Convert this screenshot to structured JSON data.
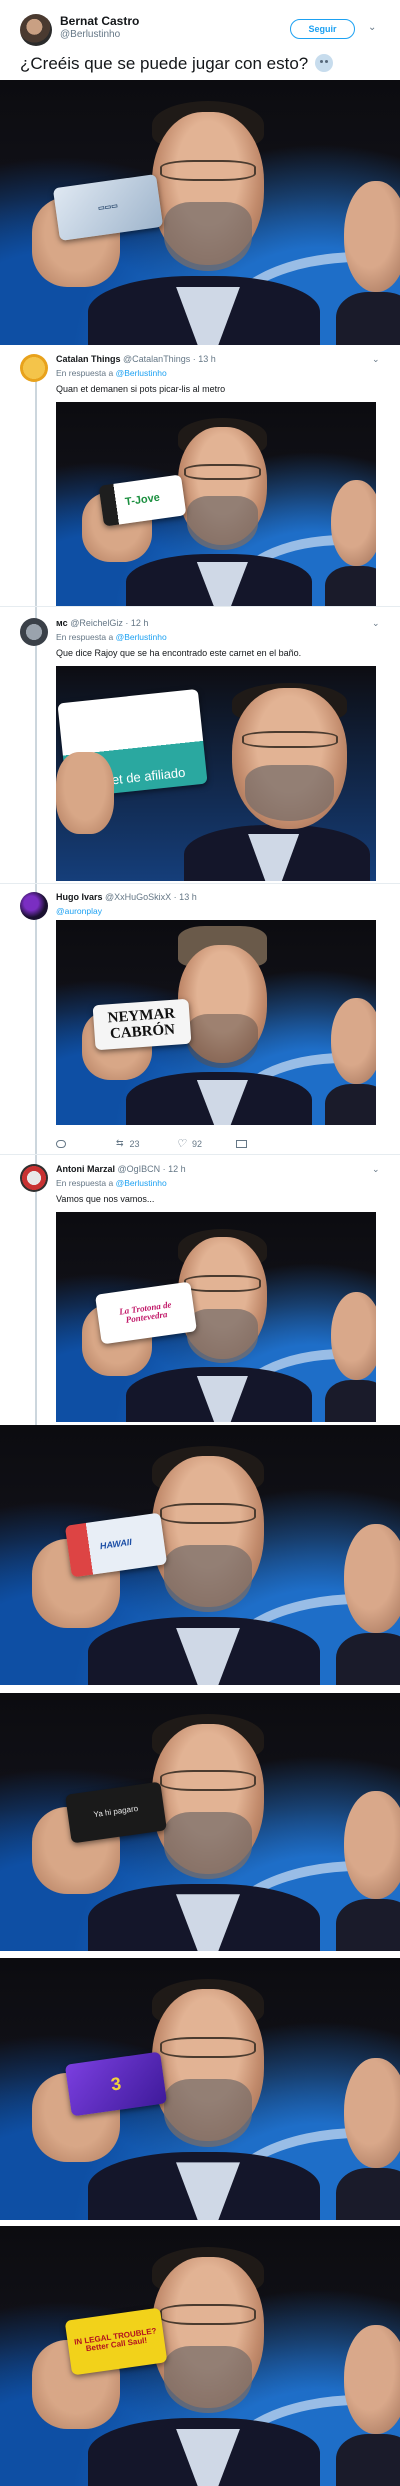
{
  "main_tweet": {
    "author_name": "Bernat Castro",
    "author_handle": "@Berlustinho",
    "follow_label": "Seguir",
    "text": "¿Creéis que se puede jugar con esto?",
    "emoji": "confused-face"
  },
  "replies": [
    {
      "name": "Catalan Things",
      "handle": "@CatalanThings · 13 h",
      "in_reply_prefix": "En respuesta a",
      "in_reply_to": "@Berlustinho",
      "text": "Quan et demanen si pots picar-lis al metro",
      "card_text": "T-Jove"
    },
    {
      "name": "ᴍᴄ",
      "handle": "@ReichelGiz · 12 h",
      "in_reply_prefix": "En respuesta a",
      "in_reply_to": "@Berlustinho",
      "text": "Que dice Rajoy que se ha encontrado este carnet en el baño.",
      "card_text": "carnet de afiliado"
    },
    {
      "name": "Hugo Ivars",
      "handle": "@XxHuGoSkixX · 13 h",
      "mention": "@auronplay",
      "card_text": "NEYMAR CABRÓN",
      "actions": {
        "retweets": "23",
        "likes": "92"
      }
    },
    {
      "name": "Antoni Marzal",
      "handle": "@OgIBCN · 12 h",
      "in_reply_prefix": "En respuesta a",
      "in_reply_to": "@Berlustinho",
      "text": "Vamos que nos vamos...",
      "card_text": "La Trotona de Pontevedra"
    }
  ],
  "extra_photos": [
    {
      "card_text": "HAWAII",
      "card_color": "#e8eef6"
    },
    {
      "card_text": "Ya hi pagaro",
      "card_color": "#1a1a1a"
    },
    {
      "card_text": "3",
      "card_color": "#5b2bb8"
    },
    {
      "card_text": "IN LEGAL TROUBLE? Better Call Saul!",
      "card_color": "#f2d21a"
    }
  ]
}
